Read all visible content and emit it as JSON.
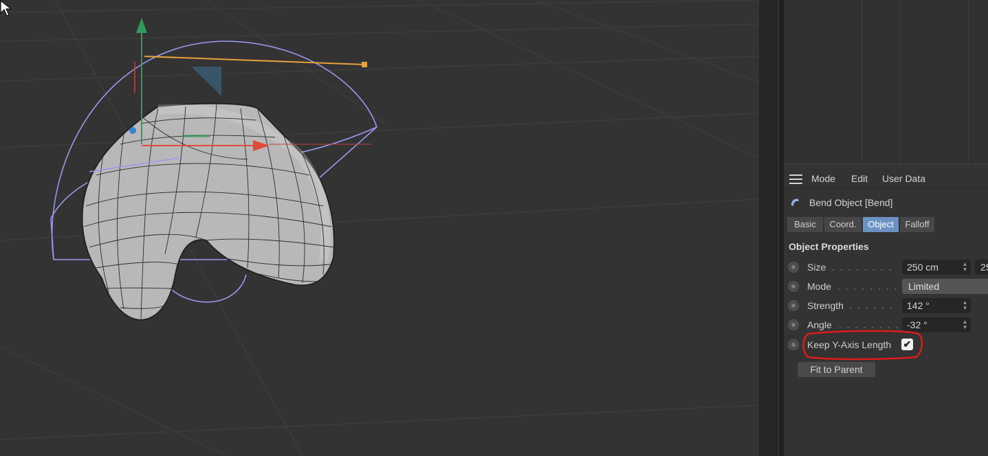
{
  "attributes": {
    "menu": [
      "Mode",
      "Edit",
      "User Data"
    ],
    "object_title": "Bend Object [Bend]",
    "tabs": [
      {
        "label": "Basic",
        "active": false
      },
      {
        "label": "Coord.",
        "active": false
      },
      {
        "label": "Object",
        "active": true
      },
      {
        "label": "Falloff",
        "active": false
      }
    ],
    "section_title": "Object Properties",
    "properties": {
      "size": {
        "label": "Size",
        "value": "250 cm",
        "value2": "25"
      },
      "mode": {
        "label": "Mode",
        "value": "Limited"
      },
      "strength": {
        "label": "Strength",
        "value": "142 °"
      },
      "angle": {
        "label": "Angle",
        "value": "-32 °"
      },
      "keep_y": {
        "label": "Keep Y-Axis Length",
        "checked": true,
        "check_glyph": "✔"
      }
    },
    "fit_button": "Fit to Parent"
  },
  "colors": {
    "accent_tab": "#6c92c4",
    "highlight_annotation": "#e01b1b",
    "deformer_cage": "#9a9af0",
    "y_axis": "#2e9b5a",
    "x_axis": "#e04a3a",
    "handle": "#e8a23a"
  },
  "icons": {
    "menu": "hamburger-icon",
    "object": "bend-deformer-icon",
    "cursor": "mouse-pointer-icon"
  }
}
